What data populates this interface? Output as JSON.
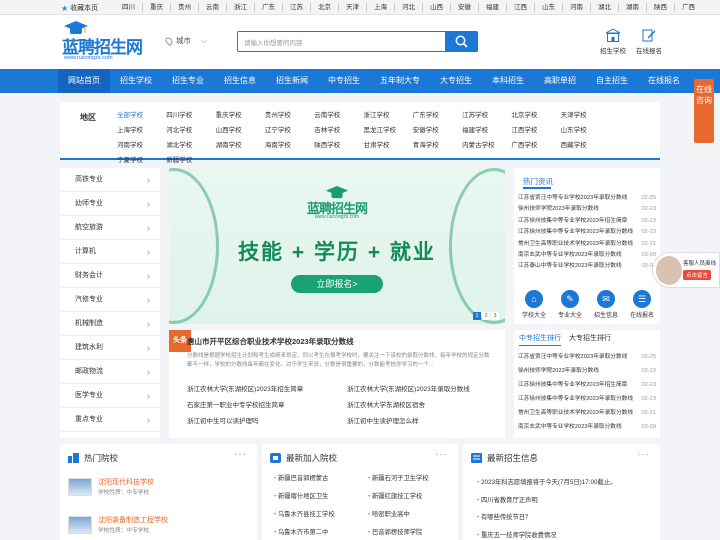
{
  "topbar": {
    "favorite": "收藏本页",
    "regions": [
      "四川",
      "重庆",
      "贵州",
      "云南",
      "浙江",
      "广东",
      "江苏",
      "北京",
      "天津",
      "上海",
      "河北",
      "山西",
      "安徽",
      "福建",
      "江西",
      "山东",
      "河南",
      "湖北",
      "湖南",
      "陕西",
      "广西"
    ]
  },
  "header": {
    "logo_name": "蓝聘招生网",
    "logo_url": "www.ruicongzs.com",
    "city": "城市",
    "search_placeholder": "请输入你想要的内容",
    "links": [
      "招生学校",
      "在线报名"
    ]
  },
  "nav": [
    "网站首页",
    "招生学校",
    "招生专业",
    "招生信息",
    "招生新闻",
    "中专招生",
    "五年制大专",
    "大专招生",
    "本科招生",
    "高职单招",
    "自主招生",
    "在线报名"
  ],
  "region_filter": {
    "label": "地区",
    "items": [
      "全部学校",
      "四川学校",
      "重庆学校",
      "贵州学校",
      "云南学校",
      "浙江学校",
      "广东学校",
      "江苏学校",
      "北京学校",
      "天津学校",
      "上海学校",
      "河北学校",
      "山西学校",
      "辽宁学校",
      "吉林学校",
      "黑龙江学校",
      "安徽学校",
      "福建学校",
      "江西学校",
      "山东学校",
      "河南学校",
      "湖北学校",
      "湖南学校",
      "海南学校",
      "陕西学校",
      "甘肃学校",
      "青海学校",
      "内蒙古学校",
      "广西学校",
      "西藏学校",
      "宁夏学校",
      "新疆学校"
    ]
  },
  "categories": [
    "高铁专业",
    "幼师专业",
    "航空旅游",
    "计算机",
    "财务会计",
    "汽修专业",
    "机械制造",
    "建筑水利",
    "邮政物流",
    "医学专业",
    "重点专业"
  ],
  "banner": {
    "logo_name": "蓝聘招生网",
    "logo_url": "www.ruicongzs.com",
    "slogan": "技能 + 学历 + 就业",
    "cta": "立即报名>",
    "dots": [
      "1",
      "2",
      "3"
    ]
  },
  "news": {
    "tag": "头条",
    "headline": "唐山市开平区综合职业技术学校2023年录取分数线",
    "summary": "分数线是根据学校招生计划和考生成绩来划定。同以考生在报考学校时，要关注一下该校的录取分数线，每年学校的规定分数都不一样，学校的分数线每年都在变化。对于学生来说，分数是很重要的，分数能考核你学习的一个...",
    "items": [
      "浙江农林大学(东湖校区)2023年招生简章",
      "浙江农林大学(东湖校区)2023年录取分数线",
      "石家庄第一职业中专学校招生简章",
      "浙江农林大学东湖校区宿舍",
      "浙江初中生可以读护理吗",
      "浙江初中生读护理怎么样"
    ]
  },
  "hot": {
    "title": "热门资讯",
    "items": [
      {
        "t": "江苏省贾汪中等专业学校2023年录取分数线",
        "d": "02-25"
      },
      {
        "t": "徐州技师学院2023年录取分数线",
        "d": "02-23"
      },
      {
        "t": "江苏徐州技集中等专业学校2023年招生简章",
        "d": "02-23"
      },
      {
        "t": "江苏徐州技集中等专业学校2023年录取分数线",
        "d": "02-23"
      },
      {
        "t": "常州卫生高等职业技术学校2023年录取分数线",
        "d": "02-21"
      },
      {
        "t": "南京玄武中等专业学校2023年录取分数线",
        "d": "03-09"
      },
      {
        "t": "江苏泰山中等专业学校2023年录取分数线",
        "d": "03-09"
      }
    ],
    "quick": [
      {
        "icon": "school-icon",
        "label": "学校大全"
      },
      {
        "icon": "major-icon",
        "label": "专业大全"
      },
      {
        "icon": "news-icon",
        "label": "招生信息"
      },
      {
        "icon": "apply-icon",
        "label": "在线报名"
      }
    ]
  },
  "rank": {
    "tabs": [
      "中专招生排行",
      "大专招生排行"
    ],
    "items": [
      {
        "t": "江苏省贾汪中等专业学校2023年录取分数线",
        "d": "02-25"
      },
      {
        "t": "徐州技师学院2023年录取分数线",
        "d": "02-23"
      },
      {
        "t": "江苏徐州技集中等专业学校2023年招生简章",
        "d": "02-23"
      },
      {
        "t": "江苏徐州技集中等专业学校2023年录取分数线",
        "d": "02-23"
      },
      {
        "t": "常州卫生高等职业技术学校2023年录取分数线",
        "d": "02-21"
      },
      {
        "t": "南京玄武中等专业学校2023年录取分数线",
        "d": "03-09"
      }
    ]
  },
  "bottom": {
    "hot_schools": {
      "title": "热门院校",
      "more": "···",
      "items": [
        {
          "name": "沈阳现代科技学校",
          "type": "学校性质：中专学校"
        },
        {
          "name": "沈阳装备制造工程学校",
          "type": "学校性质：中专学校"
        }
      ]
    },
    "new_schools": {
      "title": "最新加入院校",
      "more": "···",
      "items": [
        "新疆巴音郭楞蒙古",
        "新疆石河子卫生学校",
        "新疆喀什地区卫生",
        "新疆红旗技工学校",
        "乌鲁木齐县技工学校",
        "哈密职业高中",
        "乌鲁木齐市第二中",
        "巴音郭楞技师学院"
      ]
    },
    "news": {
      "title": "最新招生信息",
      "more": "···",
      "items": [
        "2023年科志愿填报将于今天(7月5日)17:00截止。",
        "四川省教育厅正声明",
        "有哪些传统节日？",
        "重庆五一技师学院收费情况"
      ]
    }
  },
  "float": {
    "consult": "在线咨询",
    "service": "客服人员离线",
    "leave_msg": "点击留言"
  },
  "colors": {
    "brand": "#1b78d6",
    "accent": "#e8692e",
    "banner_green": "#138a5a"
  }
}
